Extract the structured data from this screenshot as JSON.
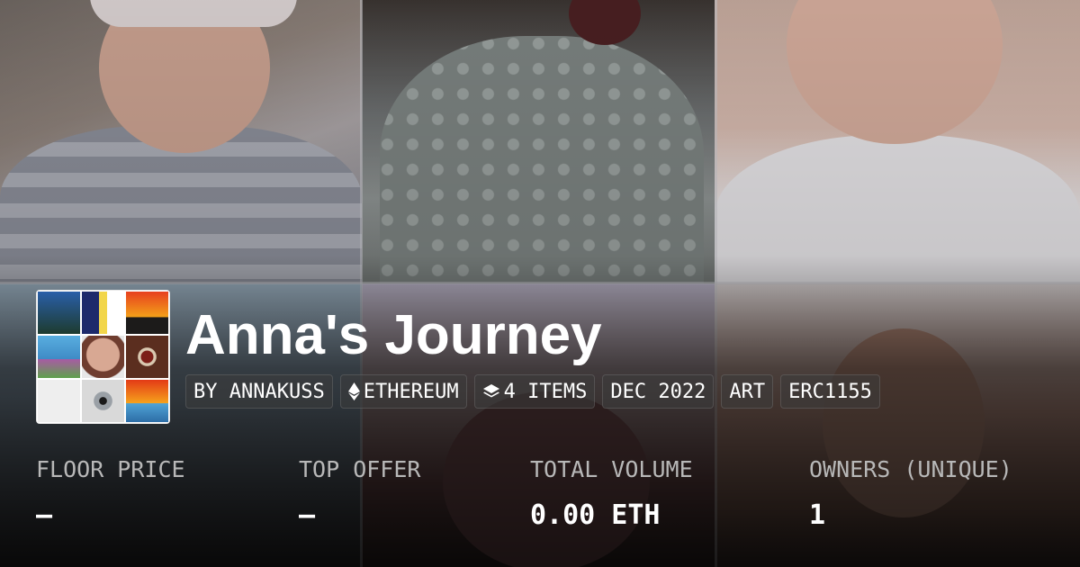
{
  "collection": {
    "title": "Anna's Journey"
  },
  "tags": {
    "creator": "BY ANNAKUSS",
    "chain": "ETHEREUM",
    "chain_icon": "ethereum-icon",
    "items": "4 ITEMS",
    "items_icon": "layers-icon",
    "date": "DEC 2022",
    "category": "ART",
    "standard": "ERC1155"
  },
  "stats": [
    {
      "label": "FLOOR PRICE",
      "value": "–"
    },
    {
      "label": "TOP OFFER",
      "value": "–"
    },
    {
      "label": "TOTAL VOLUME",
      "value": "0.00 ETH"
    },
    {
      "label": "OWNERS (UNIQUE)",
      "value": "1"
    }
  ],
  "colors": {
    "background": "#1a1a1a",
    "text": "#ffffff",
    "muted_text": "#b8b8b8"
  }
}
